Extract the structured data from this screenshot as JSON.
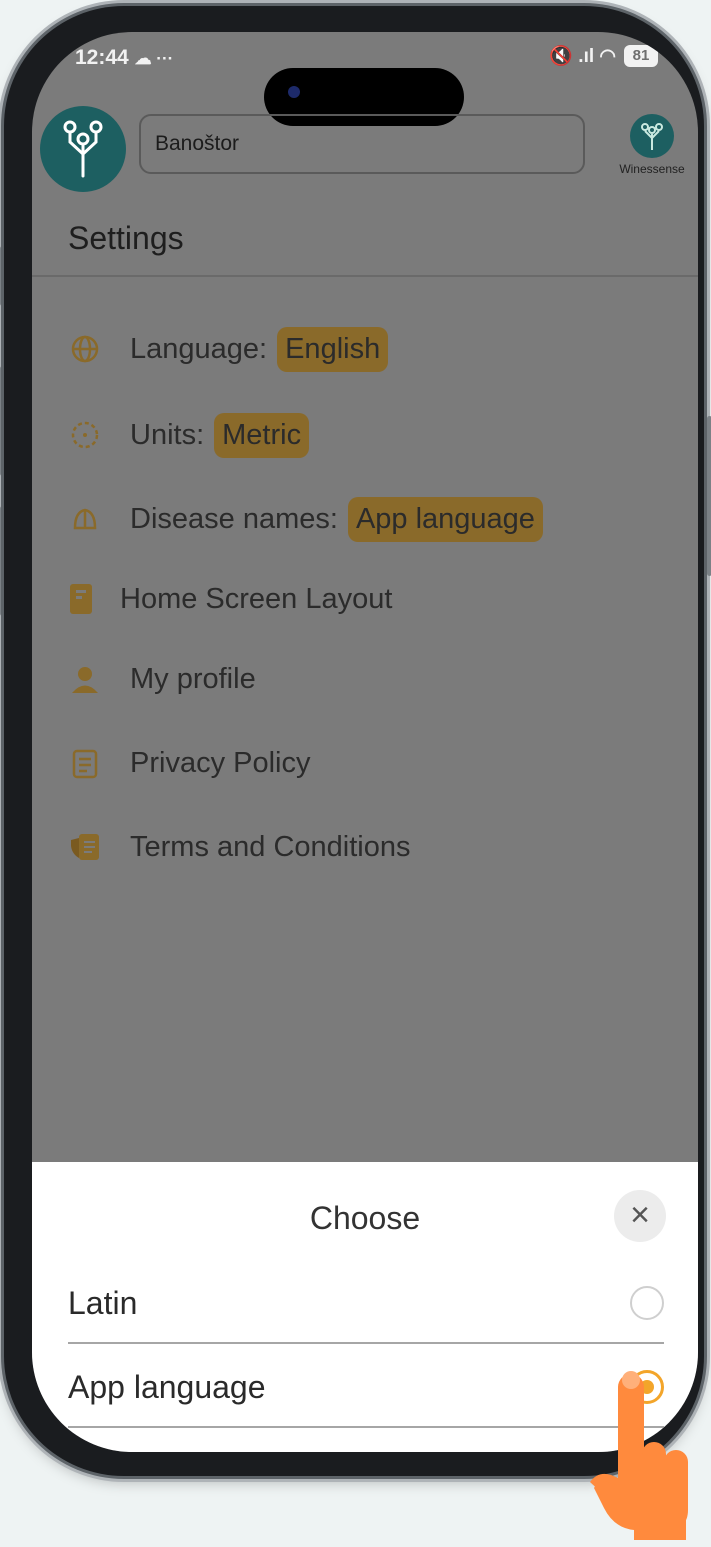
{
  "status_bar": {
    "time": "12:44",
    "extras": "☁ ···",
    "signals": "🔇 .ıl ◠",
    "battery": "81"
  },
  "header": {
    "location_value": "Banoštor",
    "brand_name": "Winessense"
  },
  "page": {
    "title": "Settings"
  },
  "settings": {
    "language_label": "Language:",
    "language_value": "English",
    "units_label": "Units:",
    "units_value": "Metric",
    "disease_label": "Disease names:",
    "disease_value": "App language",
    "home_layout": "Home Screen Layout",
    "profile": "My profile",
    "privacy": "Privacy Policy",
    "terms": "Terms and Conditions"
  },
  "sheet": {
    "title": "Choose",
    "close_glyph": "×",
    "options": [
      {
        "label": "Latin",
        "selected": false
      },
      {
        "label": "App language",
        "selected": true
      }
    ]
  },
  "colors": {
    "accent": "#8a6a2a",
    "radio_selected": "#f3a52a",
    "brand_teal": "#1d5f61",
    "pointer_hand": "#ff8a3d"
  }
}
